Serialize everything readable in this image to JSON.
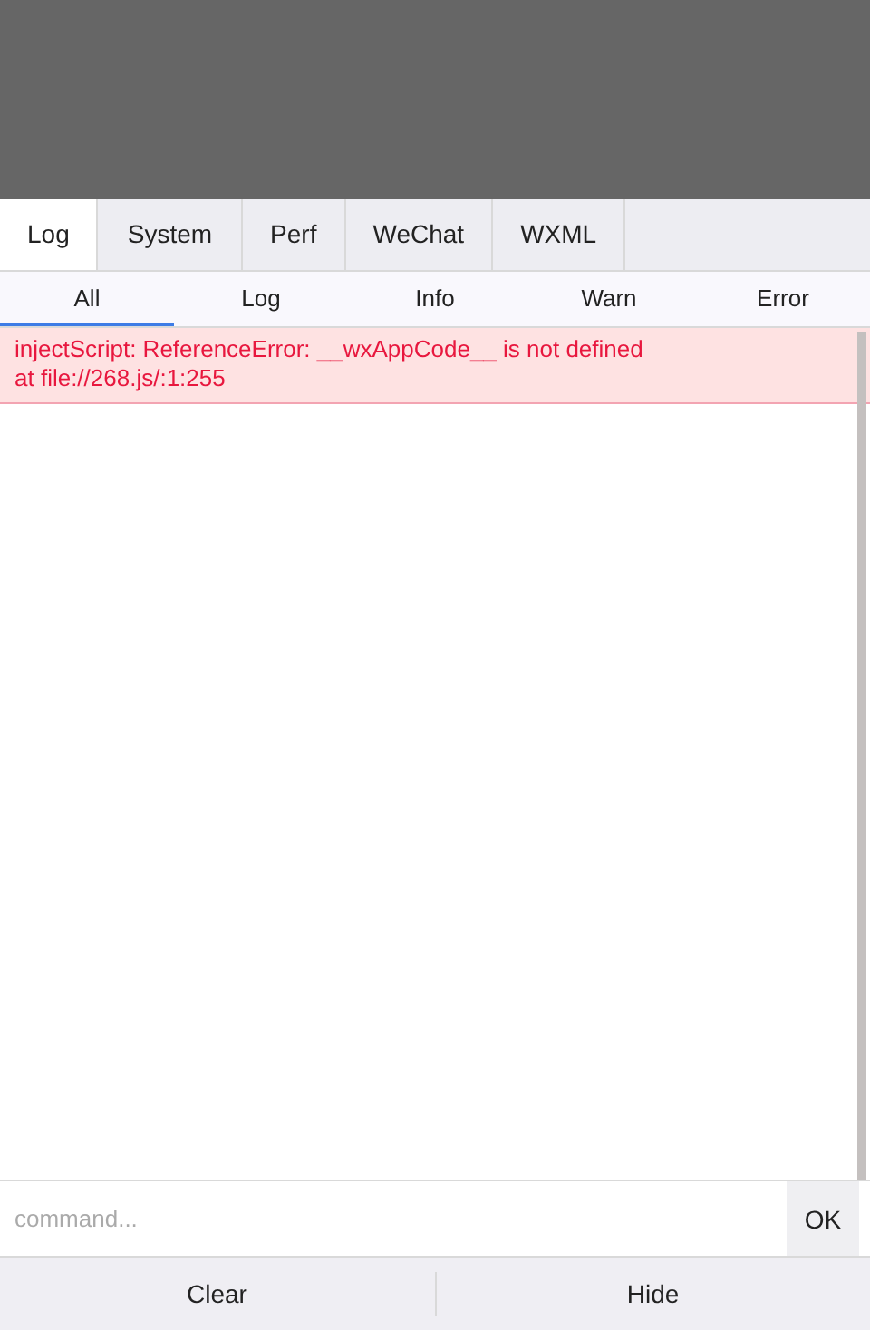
{
  "tabs": [
    {
      "label": "Log",
      "selected": true
    },
    {
      "label": "System",
      "selected": false
    },
    {
      "label": "Perf",
      "selected": false
    },
    {
      "label": "WeChat",
      "selected": false
    },
    {
      "label": "WXML",
      "selected": false
    }
  ],
  "filters": [
    {
      "label": "All",
      "selected": true
    },
    {
      "label": "Log",
      "selected": false
    },
    {
      "label": "Info",
      "selected": false
    },
    {
      "label": "Warn",
      "selected": false
    },
    {
      "label": "Error",
      "selected": false
    }
  ],
  "logs": [
    {
      "kind": "error",
      "lines": [
        "injectScript: ReferenceError: __wxAppCode__ is not defined",
        "at file://268.js/:1:255"
      ]
    }
  ],
  "command": {
    "placeholder": "command...",
    "button": "OK"
  },
  "footer": [
    "Clear",
    "Hide"
  ]
}
